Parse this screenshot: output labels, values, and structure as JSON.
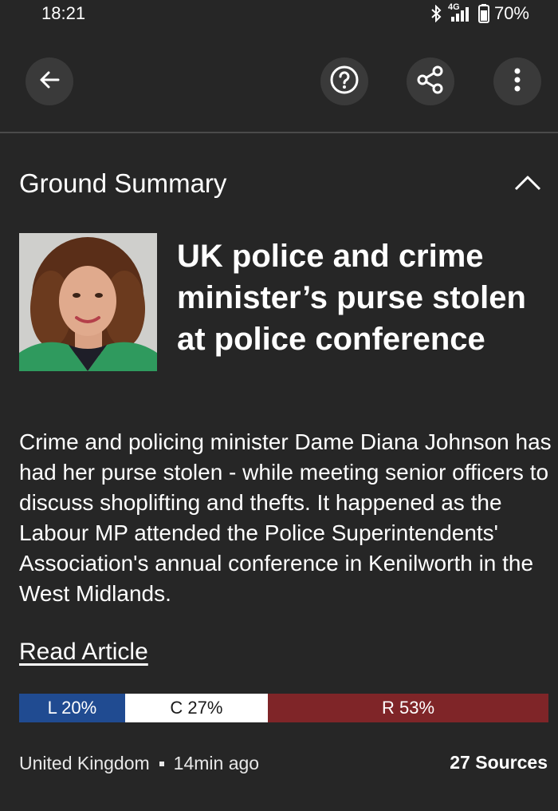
{
  "status_bar": {
    "time": "18:21",
    "network": "4G",
    "battery": "70%",
    "icons": [
      "bluetooth-icon",
      "signal-icon",
      "battery-icon"
    ]
  },
  "toolbar": {
    "back_icon": "arrow-left-icon",
    "help_icon": "question-circle-icon",
    "share_icon": "share-icon",
    "more_icon": "more-vertical-icon"
  },
  "section": {
    "title": "Ground Summary",
    "collapse_icon": "chevron-up-icon"
  },
  "article": {
    "headline": "UK police and crime minister’s purse stolen at police conference",
    "summary": "Crime and policing minister Dame Diana Johnson has had her purse stolen - while meeting senior officers to discuss shoplifting and thefts. It happened as the Labour MP attended the Police Superintendents' Association's annual conference in Kenilworth in the West Midlands.",
    "read_article_label": "Read Article"
  },
  "bias": {
    "left": {
      "label": "L 20%",
      "value": 20,
      "color": "#204b91"
    },
    "center": {
      "label": "C 27%",
      "value": 27,
      "color": "#ffffff"
    },
    "right": {
      "label": "R 53%",
      "value": 53,
      "color": "#7f2528"
    }
  },
  "meta": {
    "location": "United Kingdom",
    "time_ago": "14min ago",
    "sources": "27 Sources"
  }
}
